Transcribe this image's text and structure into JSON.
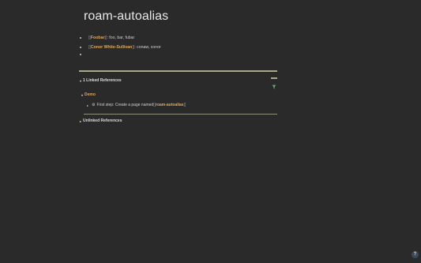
{
  "page": {
    "title": "roam-autoalias"
  },
  "blocks": [
    {
      "open": "[[",
      "link": "Foobar",
      "close": "]]",
      "rest": ": foo, bar, fubar"
    },
    {
      "open": "[[",
      "link": "Conor White-Sullivan",
      "close": "]]",
      "rest": ": conaw, conor"
    },
    {
      "open": "",
      "link": "",
      "close": "",
      "rest": ""
    }
  ],
  "linked_refs": {
    "toggle_glyph": "▾",
    "label": "1 Linked References",
    "filter_icon": "filter-icon",
    "group": {
      "toggle_glyph": "▾",
      "page": "Demo",
      "ref": {
        "toggle_glyph": "▸",
        "gear_glyph": "⚙",
        "text": "First step: Create a page named ",
        "open": "[[",
        "link": "roam-autoalias",
        "close": "]]"
      }
    }
  },
  "unlinked_refs": {
    "toggle_glyph": "▸",
    "label": "Unlinked References"
  },
  "help": {
    "label": "?"
  },
  "colors": {
    "background": "#2a2a2b",
    "link": "#e0a75b",
    "rule": "#a9a98a",
    "filter": "#6fae7a"
  }
}
